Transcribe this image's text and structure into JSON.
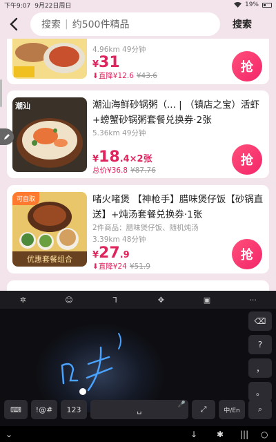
{
  "status_bar": {
    "time": "下午9:07",
    "date": "9月22日周日",
    "battery": "19%"
  },
  "header": {
    "search_label": "搜索",
    "search_count": "约500件精品",
    "search_button": "搜索"
  },
  "cards": [
    {
      "distance": "4.96km 49分钟",
      "price_int": "31",
      "discount_text": "直降¥12.6",
      "old_price": "¥43.6",
      "grab_label": "抢"
    },
    {
      "thumb_label": "潮汕",
      "title": "潮汕海鲜砂锅粥（... | （镇店之宝）活虾+螃蟹砂锅粥套餐兑换券·2张",
      "distance": "5.36km 49分钟",
      "price_int": "18",
      "price_dec": ".4",
      "price_mult": "×2张",
      "total_text": "总价¥36.8",
      "old_price": "¥87.76",
      "grab_label": "抢"
    },
    {
      "tag": "可自取",
      "thumb_label": "优惠套餐组合",
      "title": "啫火啫煲 【神枪手】腊味煲仔饭【砂锅直送】+炖汤套餐兑换券·1张",
      "items_text": "2件商品：腊味煲仔饭、随机炖汤",
      "distance": "3.39km 48分钟",
      "price_int": "27",
      "price_dec": ".9",
      "discount_text": "直降¥24",
      "old_price": "¥51.9",
      "grab_label": "抢"
    }
  ],
  "keyboard": {
    "toolbar_more": "···",
    "side_keys": [
      "?",
      "，",
      "。"
    ],
    "bottom_keys": {
      "symbols": "!@#",
      "numbers": "123",
      "lang": "中/En"
    }
  }
}
